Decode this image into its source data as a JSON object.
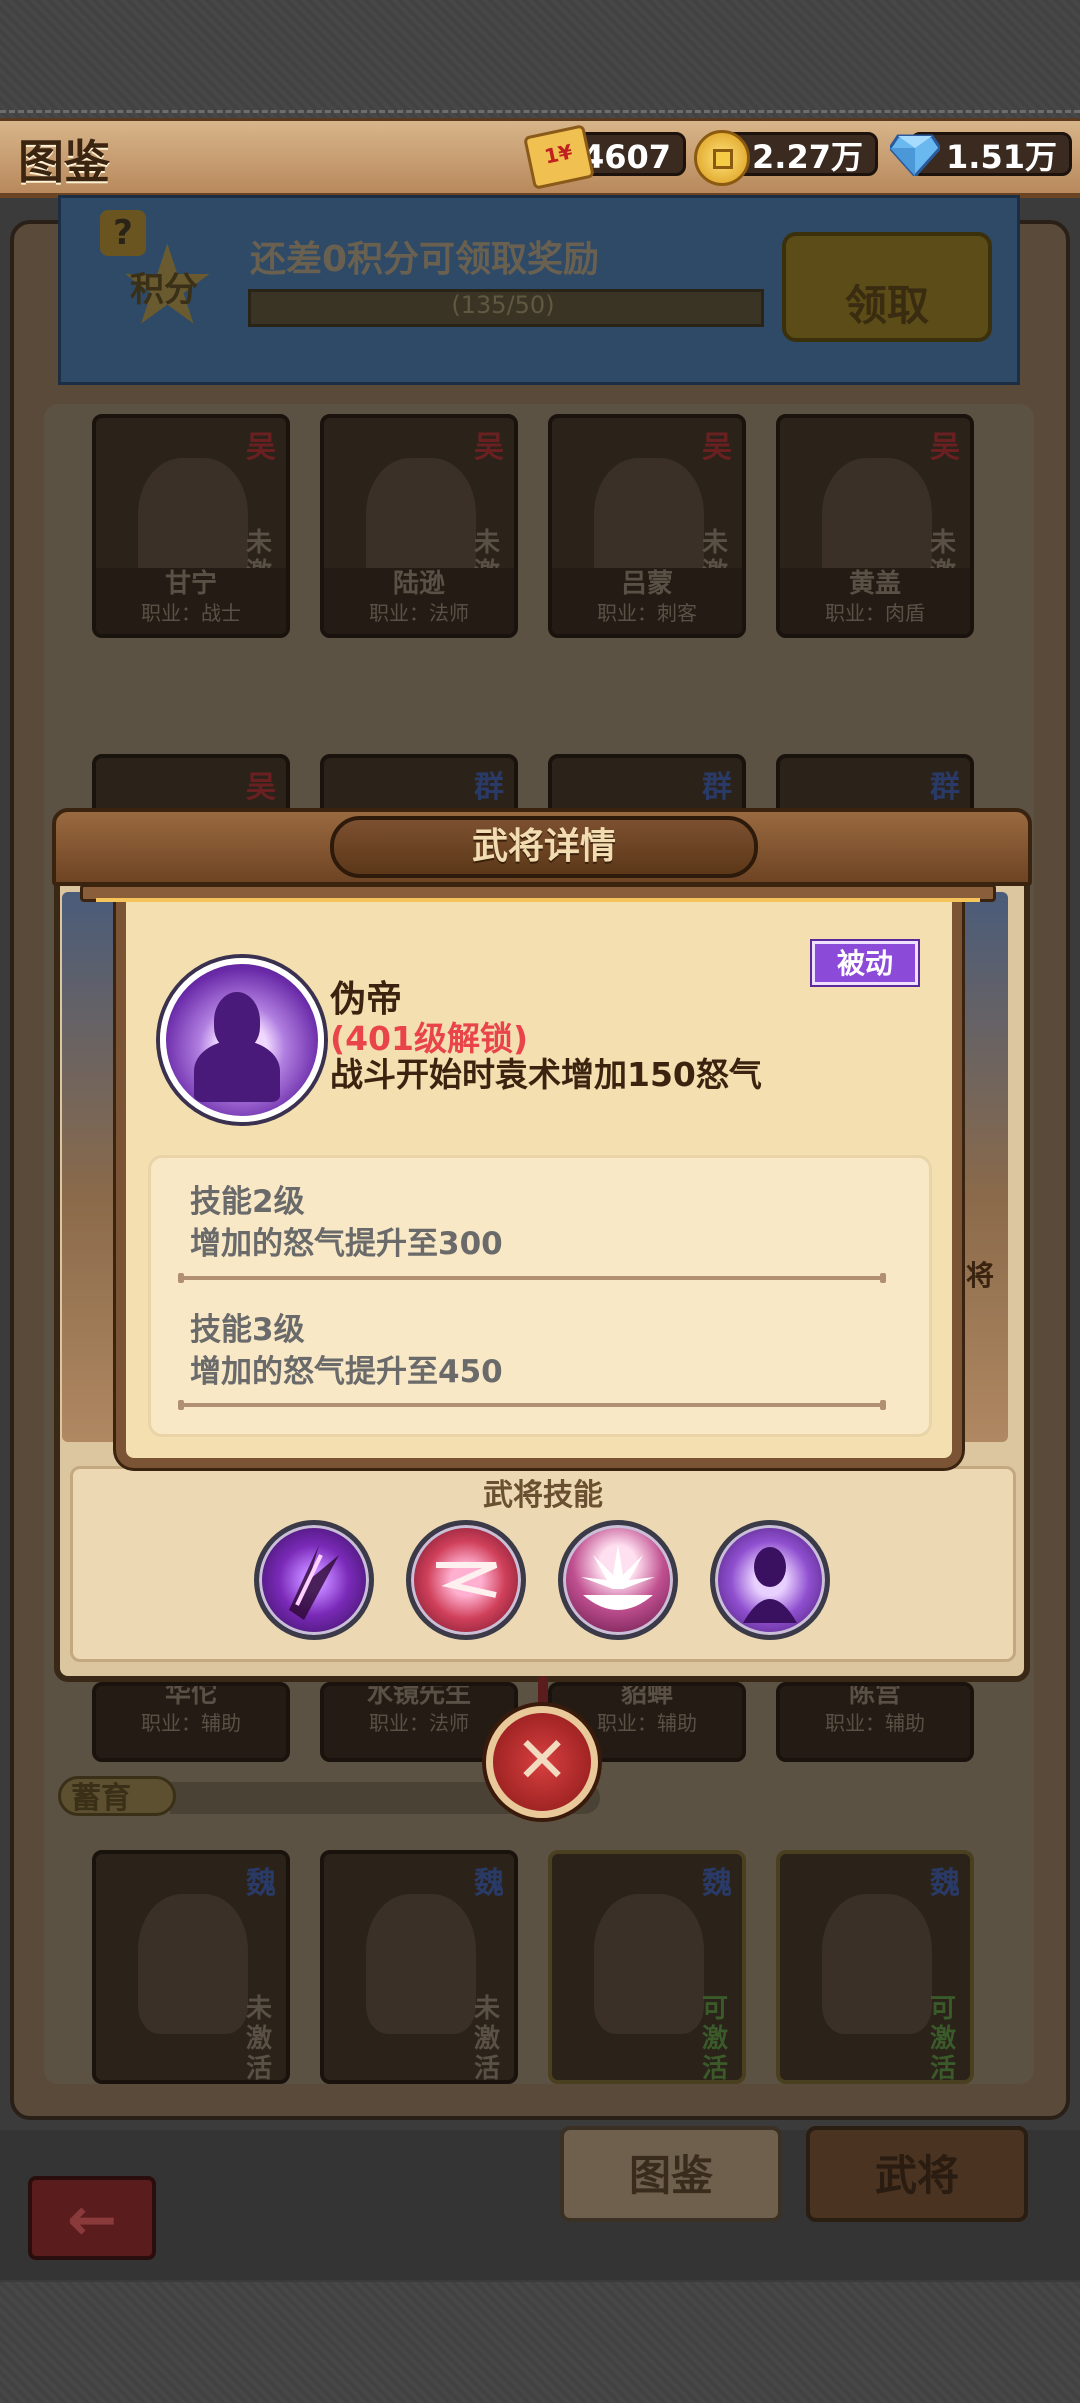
{
  "header": {
    "title": "图鉴",
    "tickets": "4607",
    "ticket_badge": "1¥",
    "gold": "2.27万",
    "diamonds": "1.51万"
  },
  "reward": {
    "badge": "?",
    "points_label": "积分",
    "text": "还差0积分可领取奖励",
    "progress_text": "(135/50)",
    "claim_label": "领取"
  },
  "heroes_top": [
    {
      "faction": "吴",
      "name": "甘宁",
      "job": "职业：战士",
      "status": "未激活"
    },
    {
      "faction": "吴",
      "name": "陆逊",
      "job": "职业：法师",
      "status": "未激活"
    },
    {
      "faction": "吴",
      "name": "吕蒙",
      "job": "职业：刺客",
      "status": "未激活"
    },
    {
      "faction": "吴",
      "name": "黄盖",
      "job": "职业：肉盾",
      "status": "未激活"
    }
  ],
  "heroes_row2_factions": [
    "吴",
    "群",
    "群",
    "群"
  ],
  "heroes_row3": [
    {
      "name": "华佗",
      "job": "职业：辅助"
    },
    {
      "name": "水镜先生",
      "job": "职业：法师"
    },
    {
      "name": "貂蝉",
      "job": "职业：辅助"
    },
    {
      "name": "陈宫",
      "job": "职业：辅助"
    }
  ],
  "section_label": "蓄育",
  "heroes_bottom": [
    {
      "faction": "魏",
      "status": "未激活"
    },
    {
      "faction": "魏",
      "status": "未激活"
    },
    {
      "faction": "魏",
      "status": "可激活"
    },
    {
      "faction": "魏",
      "status": "可激活"
    }
  ],
  "side_char": "将",
  "dialog": {
    "title": "武将详情",
    "skills_title": "武将技能",
    "close_symbol": "✕"
  },
  "skill": {
    "name": "伪帝",
    "unlock": "(401级解锁)",
    "description": "战斗开始时袁术增加150怒气",
    "type": "被动",
    "levels": [
      {
        "title": "技能2级",
        "text": "增加的怒气提升至300"
      },
      {
        "title": "技能3级",
        "text": "增加的怒气提升至450"
      }
    ]
  },
  "bottom": {
    "back_symbol": "←",
    "tab_codex": "图鉴",
    "tab_generals": "武将"
  },
  "colors": {
    "passive_badge": "#8c4ad8",
    "unlock_text": "#e8444a",
    "panel": "#f3dfb0"
  }
}
